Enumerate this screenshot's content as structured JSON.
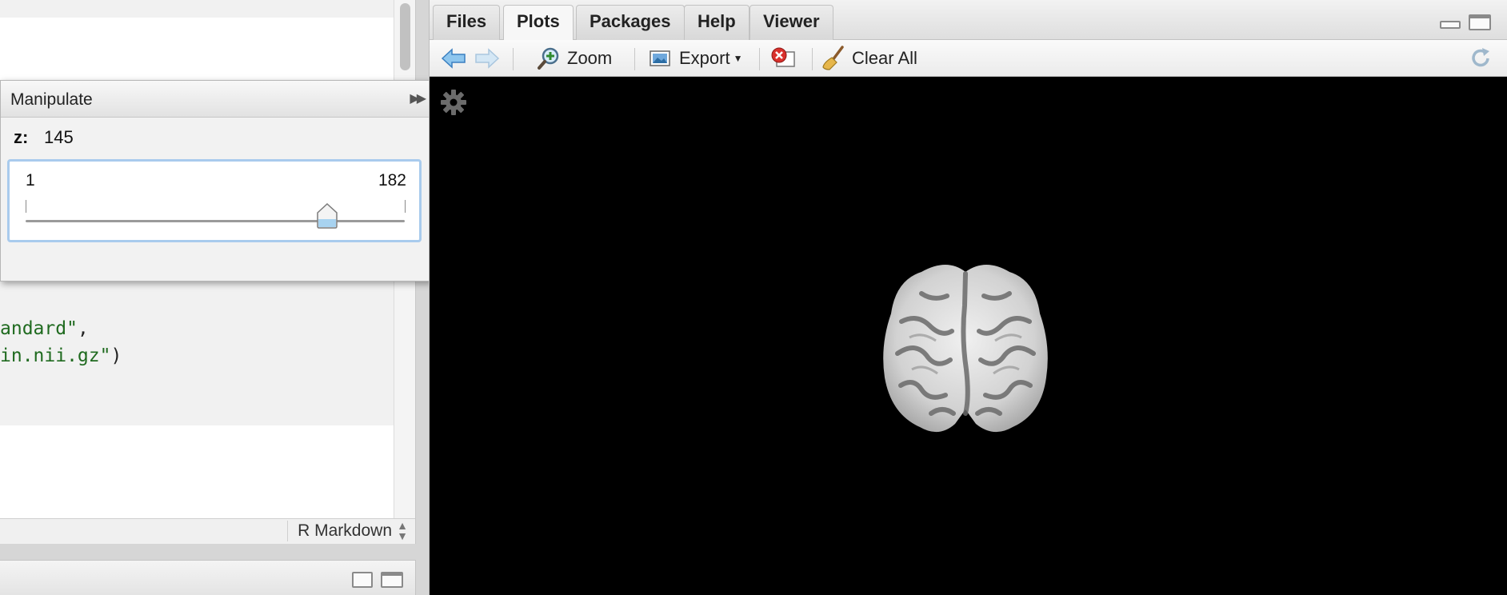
{
  "editor": {
    "code_lines": [
      {
        "text": "andard\"",
        "punct": ","
      },
      {
        "text": "in.nii.gz\"",
        "punct": ")"
      }
    ],
    "status_mode": "R Markdown"
  },
  "manipulate": {
    "title": "Manipulate",
    "variable_label": "z:",
    "value": "145",
    "slider": {
      "min": 1,
      "max": 182,
      "current": 145,
      "min_label": "1",
      "max_label": "182"
    }
  },
  "plots_pane": {
    "tabs": [
      "Files",
      "Plots",
      "Packages",
      "Help",
      "Viewer"
    ],
    "active_tab": "Plots",
    "toolbar": {
      "zoom_label": "Zoom",
      "export_label": "Export",
      "clear_label": "Clear All"
    }
  },
  "colors": {
    "plot_background": "#000000",
    "slider_focus": "#a9cbed",
    "code_string": "#1f6a1f"
  },
  "icons": [
    "back-arrow-icon",
    "forward-arrow-icon",
    "zoom-magnifier-icon",
    "export-image-icon",
    "remove-plot-icon",
    "broom-icon",
    "refresh-icon",
    "gear-icon",
    "collapse-arrows-icon",
    "minimize-icon",
    "maximize-icon"
  ]
}
